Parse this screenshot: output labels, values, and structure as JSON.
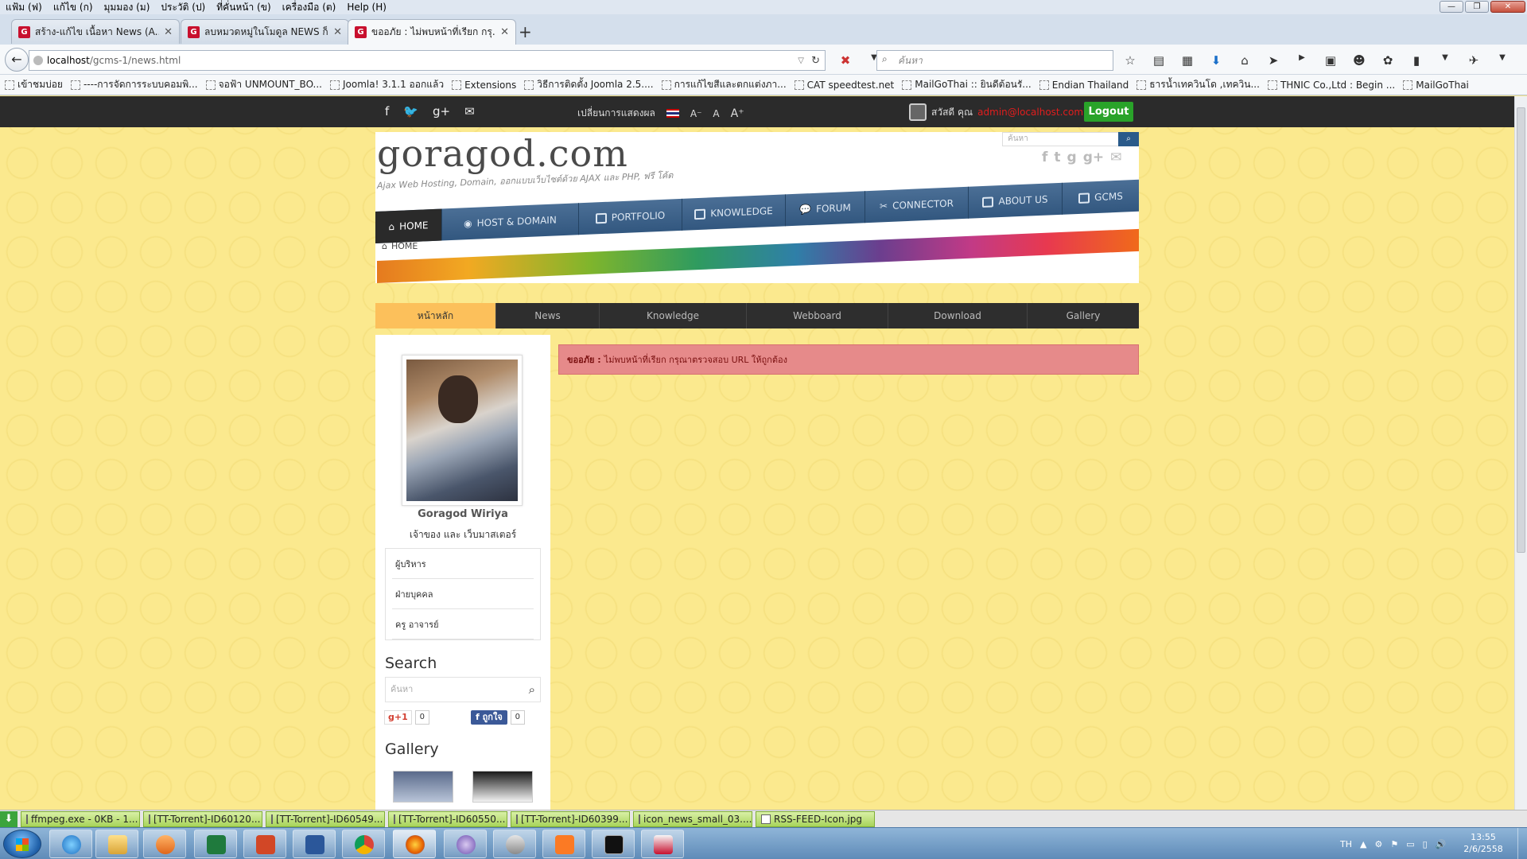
{
  "menubar": {
    "items": [
      "แฟ้ม (ฟ)",
      "แก้ไข (ก)",
      "มุมมอง (ม)",
      "ประวัติ (ป)",
      "ที่คั่นหน้า (ข)",
      "เครื่องมือ (ต)",
      "Help (H)"
    ]
  },
  "tabs": [
    {
      "title": "สร้าง-แก้ไข เนื้อหา News (A..."
    },
    {
      "title": "ลบหมวดหมู่ในโมดูล NEWS ก็..."
    },
    {
      "title": "ขออภัย : ไม่พบหน้าที่เรียก กรุ..."
    }
  ],
  "navbar": {
    "url_host": "localhost",
    "url_path": "/gcms-1/news.html",
    "search_placeholder": "ค้นหา"
  },
  "bookmarks": [
    "เข้าชมบ่อย",
    "----การจัดการระบบคอมพิ...",
    "จอฟ้า UNMOUNT_BO...",
    "Joomla! 3.1.1 ออกแล้ว",
    "Extensions",
    "วิธีการติดตั้ง Joomla 2.5....",
    "การแก้ไขสีและตกแต่งภา...",
    "CAT speedtest.net",
    "MailGoThai :: ยินดีต้อนรั...",
    "Endian Thailand",
    "ธารน้ำเทควินโด ,เทควิน...",
    "THNIC Co.,Ltd : Begin ...",
    "MailGoThai"
  ],
  "topbar": {
    "switch_label": "เปลี่ยนการแสดงผล",
    "font_small": "A⁻",
    "font_normal": "A",
    "font_large": "A⁺",
    "greeting": "สวัสดี คุณ",
    "email": "admin@localhost.com",
    "logout_label": "Logout"
  },
  "header": {
    "logo": "goragod.com",
    "tagline": "Ajax Web Hosting, Domain, ออกแบบเว็บไซต์ด้วย AJAX และ PHP, ฟรี โค้ด",
    "search_placeholder": "ค้นหา",
    "nav": [
      "HOME",
      "HOST & DOMAIN",
      "PORTFOLIO",
      "KNOWLEDGE",
      "FORUM",
      "CONNECTOR",
      "ABOUT US",
      "GCMS"
    ],
    "breadcrumb": "HOME"
  },
  "subnav": [
    "หน้าหลัก",
    "News",
    "Knowledge",
    "Webboard",
    "Download",
    "Gallery"
  ],
  "sidebar": {
    "name": "Goragod Wiriya",
    "role": "เจ้าของ และ เว็บมาสเตอร์",
    "menu": [
      "ผู้บริหาร",
      "ฝ่ายบุคคล",
      "ครู อาจารย์"
    ],
    "search_title": "Search",
    "search_placeholder": "ค้นหา",
    "gplus_label": "g+1",
    "gplus_count": "0",
    "fb_label": "ถูกใจ",
    "fb_count": "0",
    "gallery_title": "Gallery"
  },
  "alert": {
    "label": "ขออภัย :",
    "message": "ไม่พบหน้าที่เรียก กรุณาตรวจสอบ URL ให้ถูกต้อง"
  },
  "downloads": [
    "ffmpeg.exe - 0KB - 1...",
    "[TT-Torrent]-ID60120...",
    "[TT-Torrent]-ID60549...",
    "[TT-Torrent]-ID60550...",
    "[TT-Torrent]-ID60399...",
    "icon_news_small_03....",
    "RSS-FEED-Icon.jpg"
  ],
  "taskbar": {
    "lang": "TH",
    "time": "13:55",
    "date": "2/6/2558"
  },
  "colors": {
    "page_bg": "#fbe98e",
    "nav_blue": "#3a5f88",
    "subnav_active": "#fcc05b",
    "logout_green": "#29a329",
    "alert_bg": "#e68a8a"
  }
}
